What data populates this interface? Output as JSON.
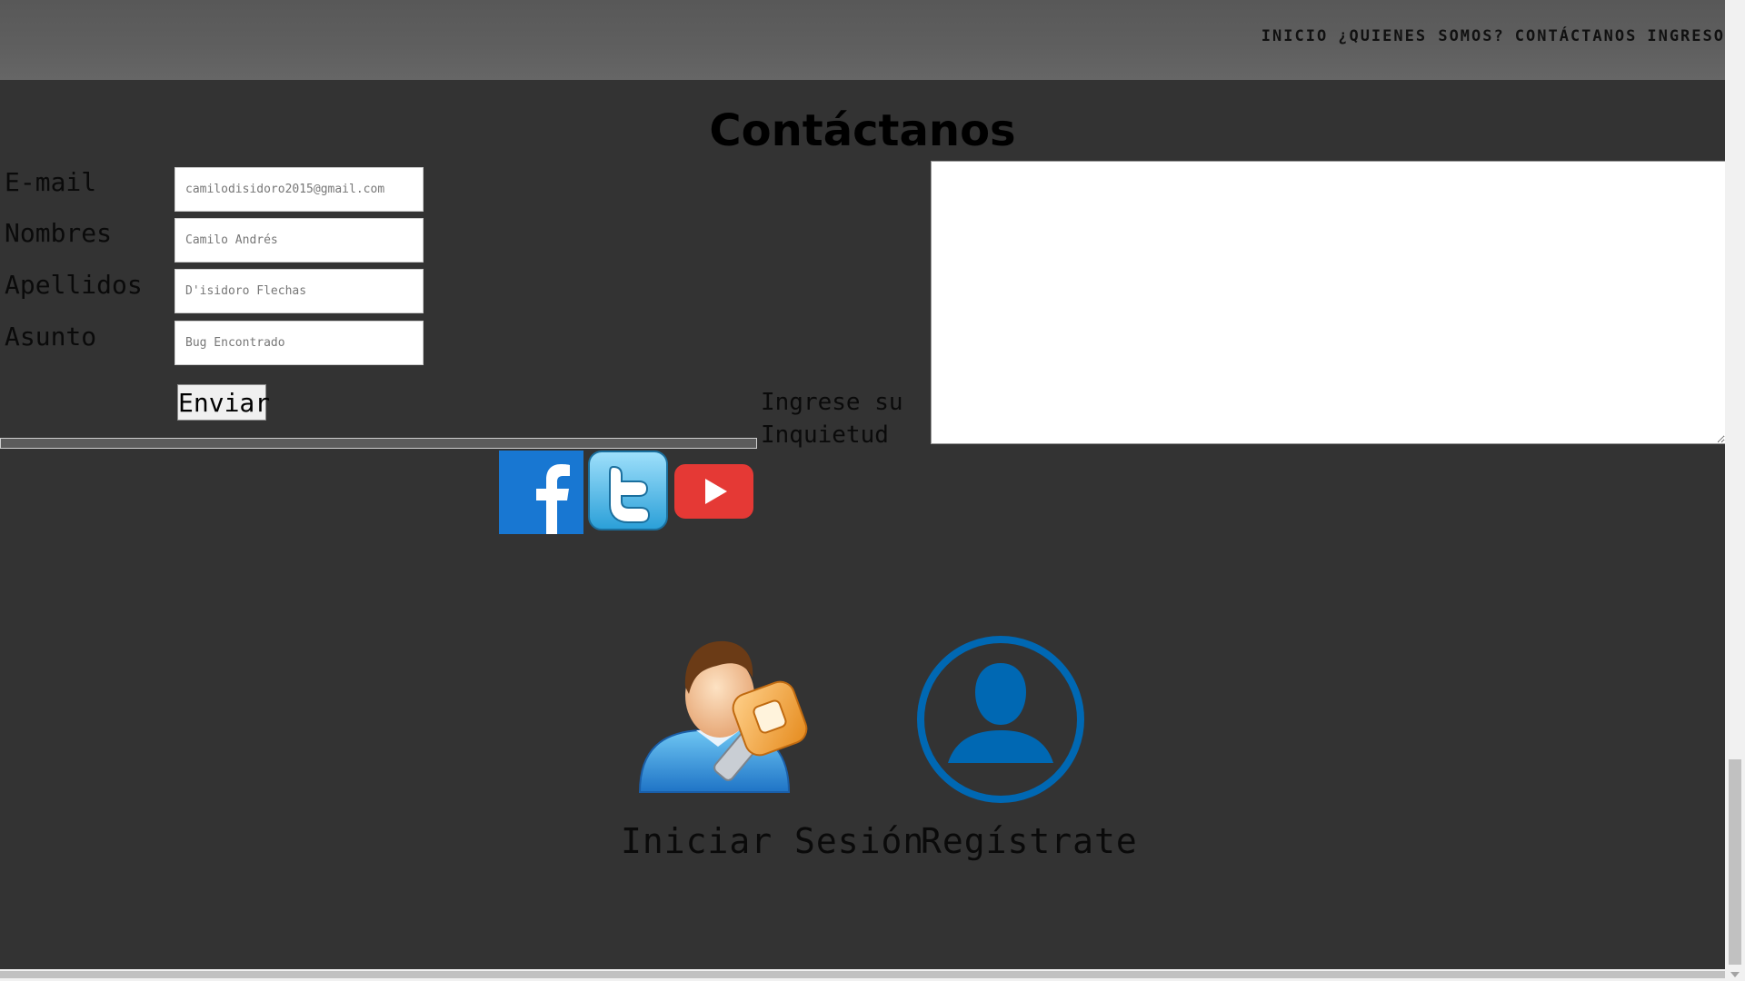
{
  "nav": {
    "items": [
      "INICIO",
      "¿QUIENES SOMOS?",
      "CONTÁCTANOS",
      "INGRESO"
    ]
  },
  "title": "Contáctanos",
  "form": {
    "email": {
      "label": "E-mail",
      "value": "camilodisidoro2015@gmail.com"
    },
    "nombres": {
      "label": "Nombres",
      "value": "Camilo Andrés"
    },
    "apellidos": {
      "label": "Apellidos",
      "value": "D'isidoro Flechas"
    },
    "asunto": {
      "label": "Asunto",
      "value": "Bug Encontrado"
    },
    "send_label": "Enviar",
    "message_label": "Ingrese su Inquietud",
    "message_value": ""
  },
  "social": {
    "icons": [
      "facebook-icon",
      "twitter-icon",
      "youtube-icon"
    ]
  },
  "auth": {
    "login_label": "Iniciar Sesión",
    "register_label": "Regístrate"
  },
  "colors": {
    "background": "#333333",
    "topbar": "#5f5f5f",
    "facebook": "#1877d2",
    "twitter": "#4fb6e8",
    "youtube": "#e53935",
    "register_blue": "#0068b3"
  }
}
